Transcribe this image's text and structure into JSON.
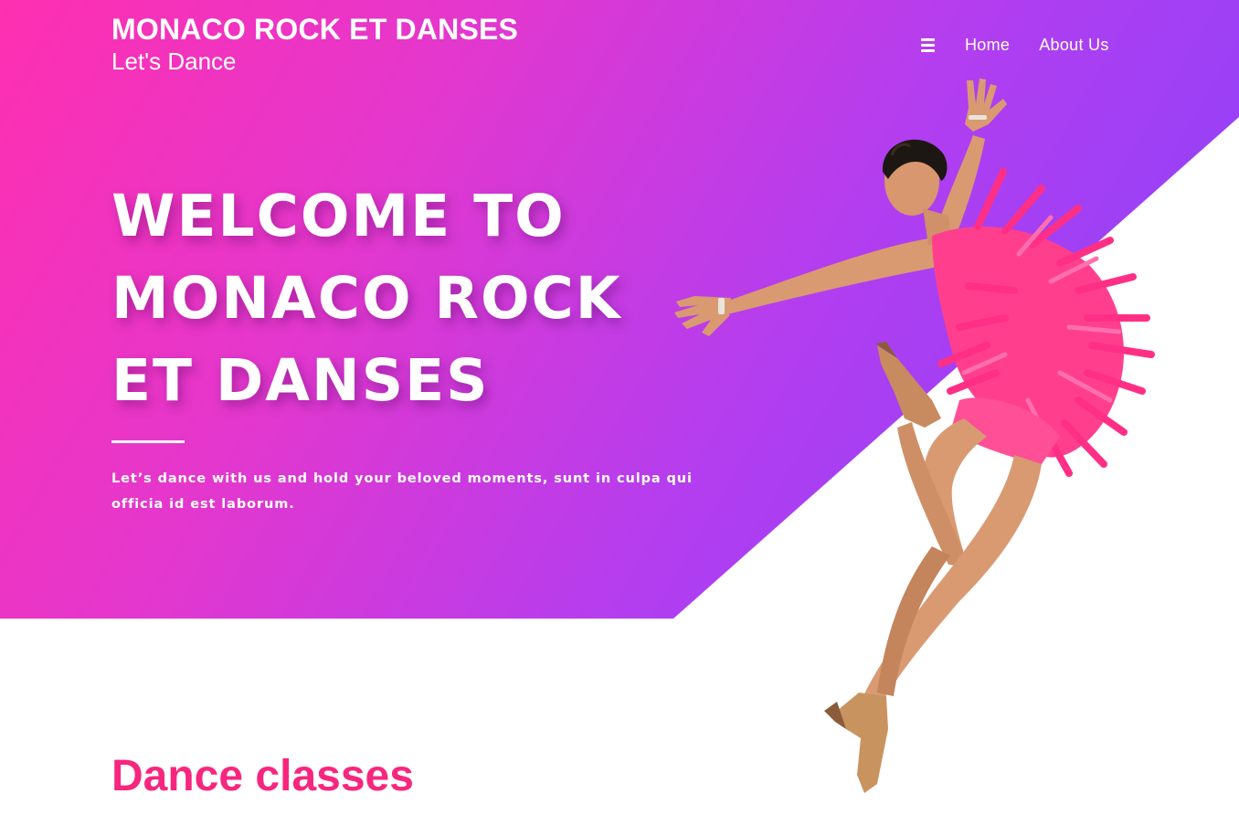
{
  "header": {
    "brand_title": "MONACO ROCK ET DANSES",
    "brand_tagline": "Let's Dance",
    "nav": [
      {
        "label": "Home"
      },
      {
        "label": "About Us"
      }
    ],
    "menu_icon": "hamburger-menu-icon"
  },
  "hero": {
    "heading": "WELCOME TO MONACO ROCK ET DANSES",
    "text": "Let’s dance with us and hold your beloved moments, sunt in culpa qui officia id est laborum.",
    "image": "dancer-photo"
  },
  "classes": {
    "title": "Dance classes"
  },
  "colors": {
    "gradient_start": "#fe2fb0",
    "gradient_end": "#8442fb",
    "accent": "#f7267f",
    "text_on_hero": "#ffffff"
  }
}
